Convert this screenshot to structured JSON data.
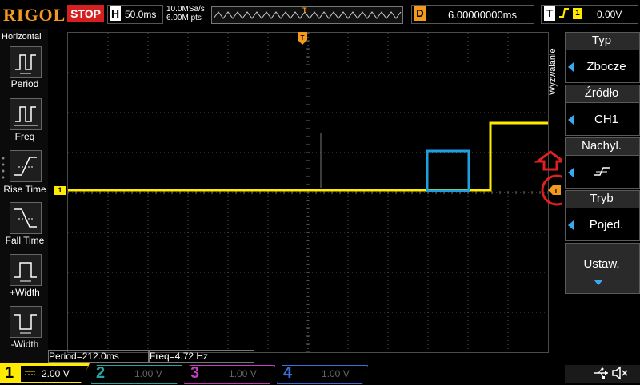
{
  "topbar": {
    "logo": "RIGOL",
    "run_state": "STOP",
    "horizontal_letter": "H",
    "timebase": "50.0ms",
    "sample_rate": "10.0MSa/s",
    "memory_depth": "6.00M pts",
    "mem_marker": "T",
    "delay_letter": "D",
    "delay_value": "6.00000000ms",
    "trigger_letter": "T",
    "trigger_channel": "1",
    "trigger_level": "0.00V"
  },
  "left_menu": {
    "title": "Horizontal",
    "items": [
      {
        "label": "Period",
        "icon": "period-icon"
      },
      {
        "label": "Freq",
        "icon": "freq-icon"
      },
      {
        "label": "Rise Time",
        "icon": "rise-time-icon"
      },
      {
        "label": "Fall Time",
        "icon": "fall-time-icon"
      },
      {
        "label": "+Width",
        "icon": "plus-width-icon"
      },
      {
        "label": "-Width",
        "icon": "minus-width-icon"
      }
    ]
  },
  "right_menu": {
    "vertical_label": "Wyzwalanie",
    "type_title": "Typ",
    "type_value": "Zbocze",
    "source_title": "Źródło",
    "source_value": "CH1",
    "slope_title": "Nachyl.",
    "mode_title": "Tryb",
    "mode_value": "Pojed.",
    "settings_label": "Ustaw."
  },
  "markers": {
    "ch1_marker": "1",
    "trigger_top": "T",
    "trigger_right": "T"
  },
  "measurements": {
    "period": "Period=212.0ms",
    "freq": "Freq=4.72 Hz"
  },
  "channels": [
    {
      "num": "1",
      "volts": "2.00 V",
      "color": "#ffeb00",
      "active": true
    },
    {
      "num": "2",
      "volts": "1.00 V",
      "color": "#2aa4a0",
      "active": false
    },
    {
      "num": "3",
      "volts": "1.00 V",
      "color": "#c43fbf",
      "active": false
    },
    {
      "num": "4",
      "volts": "1.00 V",
      "color": "#3a6fd8",
      "active": false
    }
  ],
  "colors": {
    "ch1": "#ffeb00",
    "accent": "#f39a1e",
    "stop": "#d62020",
    "annotation_red": "#e02020",
    "annotation_blue": "#1e9fe0",
    "menu_arrow": "#3ba9f0"
  }
}
